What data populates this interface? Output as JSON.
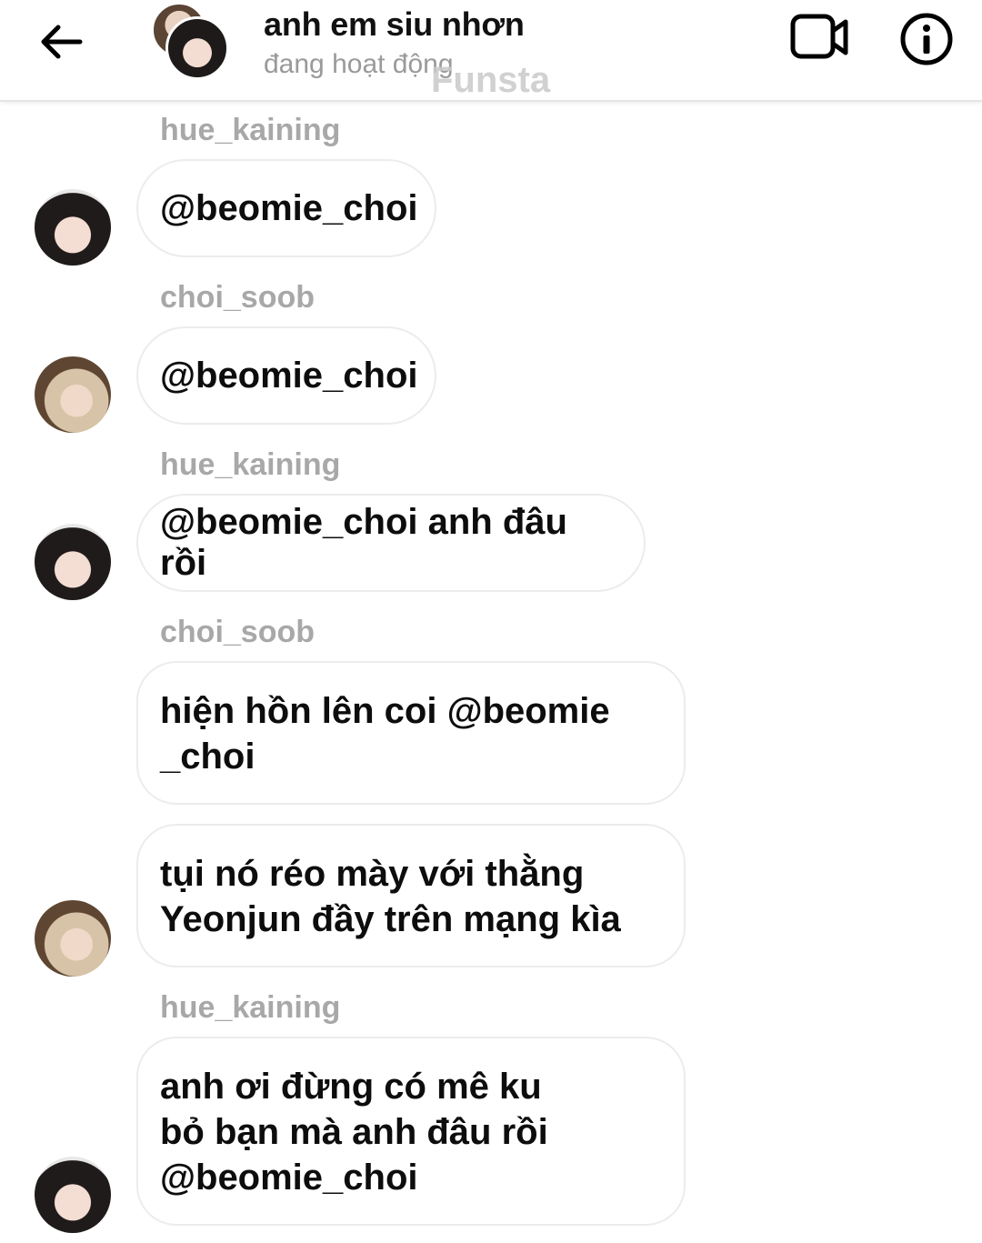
{
  "header": {
    "title": "anh em siu nhơn",
    "status": "đang hoạt động",
    "watermark": "Funsta",
    "icons": {
      "back": "arrow-left-icon",
      "video": "video-camera-icon",
      "info": "info-icon"
    }
  },
  "messages": [
    {
      "sender": "hue_kaining",
      "avatar": "avatar-hue",
      "text": "@beomie_choi"
    },
    {
      "sender": "choi_soob",
      "avatar": "avatar-soob",
      "text": "@beomie_choi"
    },
    {
      "sender": "hue_kaining",
      "avatar": "avatar-hue",
      "text": "@beomie_choi anh đâu rồi"
    },
    {
      "sender": "choi_soob",
      "avatar": "",
      "text": "hiện hồn lên coi @beomie\n_choi"
    },
    {
      "sender": "",
      "avatar": "avatar-soob",
      "text": "tụi nó réo mày với thằng\nYeonjun đầy trên mạng kìa"
    },
    {
      "sender": "hue_kaining",
      "avatar": "avatar-hue",
      "text": "anh ơi đừng có mê ku\nbỏ bạn mà anh đâu rồi\n@beomie_choi"
    }
  ],
  "colors": {
    "bubble_border": "#ececec",
    "sender_text": "#a8a8a8",
    "status_text": "#9a9a9a"
  }
}
